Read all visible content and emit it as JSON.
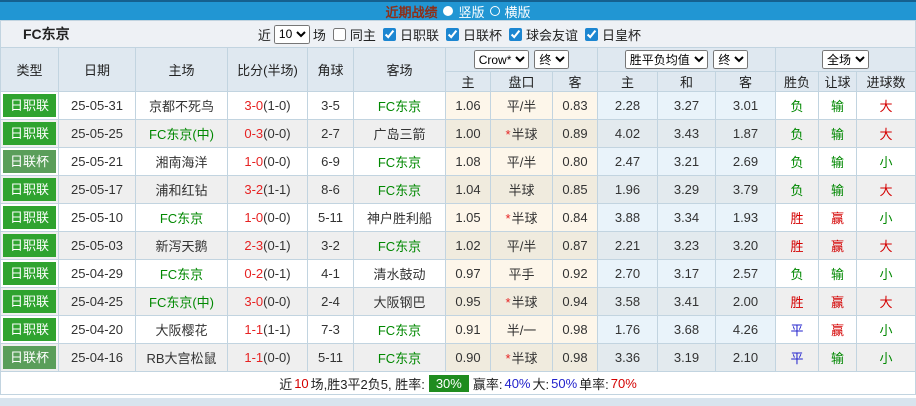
{
  "colors": {
    "topbar": "#2196d3",
    "topbar-dark": "#15608f",
    "title-text": "#8e2f18",
    "header-bg": "#dfe8f0",
    "border": "#c2d4e0",
    "j1-green": "#2fa32f",
    "cup-green": "#5a9e5a",
    "score-red": "#e62222",
    "result-green": "#008800",
    "result-red": "#d40000",
    "result-blue": "#2222cc",
    "crow-odd": "#fdf6ea",
    "crow-even": "#f0ebde",
    "avg-odd": "#e9f3fa",
    "avg-even": "#e3eaee",
    "badge-green": "#1f8c1f",
    "strip": "#d8e4ee"
  },
  "title_bar": {
    "title": "近期战绩",
    "vertical_label": "竖版",
    "horizontal_label": "横版"
  },
  "filter": {
    "team_name": "FC东京",
    "recent_label": "近",
    "recent_value": "10",
    "matches_label": "场",
    "same_home_label": "同主",
    "leagues": [
      "日职联",
      "日联杯",
      "球会友谊",
      "日皇杯"
    ]
  },
  "table": {
    "star_char": "*",
    "headers": {
      "type": "类型",
      "date": "日期",
      "home": "主场",
      "score": "比分(半场)",
      "corner": "角球",
      "away": "客场"
    },
    "selects": {
      "crow": "Crow*",
      "crow_stage": "终",
      "avg": "胜平负均值",
      "avg_stage": "终",
      "scope": "全场"
    },
    "crow_sub": [
      "主",
      "盘口",
      "客"
    ],
    "avg_sub": [
      "主",
      "和",
      "客"
    ],
    "full_sub": [
      "胜负",
      "让球",
      "进球数"
    ],
    "rows": [
      {
        "league": {
          "text": "日职联",
          "style": "j1"
        },
        "date": "25-05-31",
        "home": {
          "text": "京都不死鸟",
          "green": false
        },
        "score": "3-0",
        "half_score": "(1-0)",
        "corners": "3-5",
        "away": {
          "text": "FC东京",
          "green": true
        },
        "crow_home": "1.06",
        "handicap": {
          "text": "平/半",
          "star": false
        },
        "crow_away": "0.83",
        "avg_win": "2.28",
        "avg_draw": "3.27",
        "avg_lose": "3.01",
        "result": {
          "text": "负",
          "color": "green"
        },
        "handicap_result": {
          "text": "输",
          "color": "green"
        },
        "goal_result": {
          "text": "大",
          "color": "red"
        }
      },
      {
        "league": {
          "text": "日职联",
          "style": "j1"
        },
        "date": "25-05-25",
        "home": {
          "text": "FC东京(中)",
          "green": true
        },
        "score": "0-3",
        "half_score": "(0-0)",
        "corners": "2-7",
        "away": {
          "text": "广岛三箭",
          "green": false
        },
        "crow_home": "1.00",
        "handicap": {
          "text": "半球",
          "star": true
        },
        "crow_away": "0.89",
        "avg_win": "4.02",
        "avg_draw": "3.43",
        "avg_lose": "1.87",
        "result": {
          "text": "负",
          "color": "green"
        },
        "handicap_result": {
          "text": "输",
          "color": "green"
        },
        "goal_result": {
          "text": "大",
          "color": "red"
        }
      },
      {
        "league": {
          "text": "日联杯",
          "style": "cup"
        },
        "date": "25-05-21",
        "home": {
          "text": "湘南海洋",
          "green": false
        },
        "score": "1-0",
        "half_score": "(0-0)",
        "corners": "6-9",
        "away": {
          "text": "FC东京",
          "green": true
        },
        "crow_home": "1.08",
        "handicap": {
          "text": "平/半",
          "star": false
        },
        "crow_away": "0.80",
        "avg_win": "2.47",
        "avg_draw": "3.21",
        "avg_lose": "2.69",
        "result": {
          "text": "负",
          "color": "green"
        },
        "handicap_result": {
          "text": "输",
          "color": "green"
        },
        "goal_result": {
          "text": "小",
          "color": "green"
        }
      },
      {
        "league": {
          "text": "日职联",
          "style": "j1"
        },
        "date": "25-05-17",
        "home": {
          "text": "浦和红钻",
          "green": false
        },
        "score": "3-2",
        "half_score": "(1-1)",
        "corners": "8-6",
        "away": {
          "text": "FC东京",
          "green": true
        },
        "crow_home": "1.04",
        "handicap": {
          "text": "半球",
          "star": false
        },
        "crow_away": "0.85",
        "avg_win": "1.96",
        "avg_draw": "3.29",
        "avg_lose": "3.79",
        "result": {
          "text": "负",
          "color": "green"
        },
        "handicap_result": {
          "text": "输",
          "color": "green"
        },
        "goal_result": {
          "text": "大",
          "color": "red"
        }
      },
      {
        "league": {
          "text": "日职联",
          "style": "j1"
        },
        "date": "25-05-10",
        "home": {
          "text": "FC东京",
          "green": true
        },
        "score": "1-0",
        "half_score": "(0-0)",
        "corners": "5-11",
        "away": {
          "text": "神户胜利船",
          "green": false
        },
        "crow_home": "1.05",
        "handicap": {
          "text": "半球",
          "star": true
        },
        "crow_away": "0.84",
        "avg_win": "3.88",
        "avg_draw": "3.34",
        "avg_lose": "1.93",
        "result": {
          "text": "胜",
          "color": "red"
        },
        "handicap_result": {
          "text": "赢",
          "color": "red"
        },
        "goal_result": {
          "text": "小",
          "color": "green"
        }
      },
      {
        "league": {
          "text": "日职联",
          "style": "j1"
        },
        "date": "25-05-03",
        "home": {
          "text": "新泻天鹅",
          "green": false
        },
        "score": "2-3",
        "half_score": "(0-1)",
        "corners": "3-2",
        "away": {
          "text": "FC东京",
          "green": true
        },
        "crow_home": "1.02",
        "handicap": {
          "text": "平/半",
          "star": false
        },
        "crow_away": "0.87",
        "avg_win": "2.21",
        "avg_draw": "3.23",
        "avg_lose": "3.20",
        "result": {
          "text": "胜",
          "color": "red"
        },
        "handicap_result": {
          "text": "赢",
          "color": "red"
        },
        "goal_result": {
          "text": "大",
          "color": "red"
        }
      },
      {
        "league": {
          "text": "日职联",
          "style": "j1"
        },
        "date": "25-04-29",
        "home": {
          "text": "FC东京",
          "green": true
        },
        "score": "0-2",
        "half_score": "(0-1)",
        "corners": "4-1",
        "away": {
          "text": "清水鼓动",
          "green": false
        },
        "crow_home": "0.97",
        "handicap": {
          "text": "平手",
          "star": false
        },
        "crow_away": "0.92",
        "avg_win": "2.70",
        "avg_draw": "3.17",
        "avg_lose": "2.57",
        "result": {
          "text": "负",
          "color": "green"
        },
        "handicap_result": {
          "text": "输",
          "color": "green"
        },
        "goal_result": {
          "text": "小",
          "color": "green"
        }
      },
      {
        "league": {
          "text": "日职联",
          "style": "j1"
        },
        "date": "25-04-25",
        "home": {
          "text": "FC东京(中)",
          "green": true
        },
        "score": "3-0",
        "half_score": "(0-0)",
        "corners": "2-4",
        "away": {
          "text": "大阪钢巴",
          "green": false
        },
        "crow_home": "0.95",
        "handicap": {
          "text": "半球",
          "star": true
        },
        "crow_away": "0.94",
        "avg_win": "3.58",
        "avg_draw": "3.41",
        "avg_lose": "2.00",
        "result": {
          "text": "胜",
          "color": "red"
        },
        "handicap_result": {
          "text": "赢",
          "color": "red"
        },
        "goal_result": {
          "text": "大",
          "color": "red"
        }
      },
      {
        "league": {
          "text": "日职联",
          "style": "j1"
        },
        "date": "25-04-20",
        "home": {
          "text": "大阪樱花",
          "green": false
        },
        "score": "1-1",
        "half_score": "(1-1)",
        "corners": "7-3",
        "away": {
          "text": "FC东京",
          "green": true
        },
        "crow_home": "0.91",
        "handicap": {
          "text": "半/一",
          "star": false
        },
        "crow_away": "0.98",
        "avg_win": "1.76",
        "avg_draw": "3.68",
        "avg_lose": "4.26",
        "result": {
          "text": "平",
          "color": "blue"
        },
        "handicap_result": {
          "text": "赢",
          "color": "red"
        },
        "goal_result": {
          "text": "小",
          "color": "green"
        }
      },
      {
        "league": {
          "text": "日联杯",
          "style": "cup"
        },
        "date": "25-04-16",
        "home": {
          "text": "RB大宫松鼠",
          "green": false
        },
        "score": "1-1",
        "half_score": "(0-0)",
        "corners": "5-11",
        "away": {
          "text": "FC东京",
          "green": true
        },
        "crow_home": "0.90",
        "handicap": {
          "text": "半球",
          "star": true
        },
        "crow_away": "0.98",
        "avg_win": "3.36",
        "avg_draw": "3.19",
        "avg_lose": "2.10",
        "result": {
          "text": "平",
          "color": "blue"
        },
        "handicap_result": {
          "text": "输",
          "color": "green"
        },
        "goal_result": {
          "text": "小",
          "color": "green"
        }
      }
    ]
  },
  "summary": {
    "parts": [
      {
        "text": "近",
        "color": "black"
      },
      {
        "text": "10",
        "color": "red"
      },
      {
        "text": "场,胜3平2负5, 胜率:",
        "color": "black"
      },
      {
        "text": "30%",
        "badge": true
      },
      {
        "text": "赢率:",
        "color": "black"
      },
      {
        "text": "40%",
        "color": "blue"
      },
      {
        "text": " 大:",
        "color": "black"
      },
      {
        "text": "50%",
        "color": "blue"
      },
      {
        "text": " 单率:",
        "color": "black"
      },
      {
        "text": "70%",
        "color": "red"
      }
    ]
  }
}
